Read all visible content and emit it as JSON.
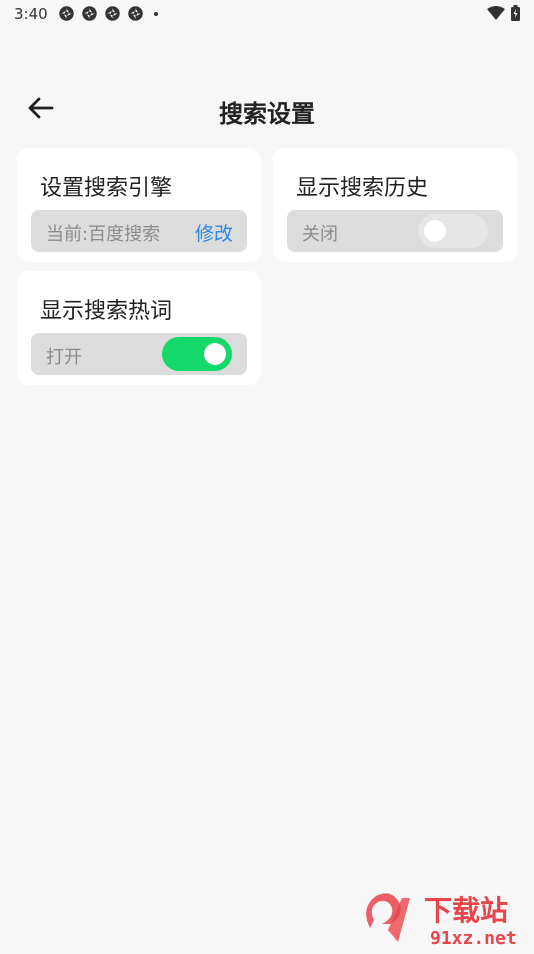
{
  "status_bar": {
    "time": "3:40"
  },
  "header": {
    "title": "搜索设置"
  },
  "cards": {
    "engine": {
      "title": "设置搜索引擎",
      "current": "当前:百度搜索",
      "modify_label": "修改"
    },
    "history": {
      "title": "显示搜索历史",
      "state_label": "关闭",
      "enabled": false
    },
    "hotwords": {
      "title": "显示搜索热词",
      "state_label": "打开",
      "enabled": true
    }
  },
  "watermark": {
    "text": "下载站",
    "domain": "91xz.net"
  },
  "colors": {
    "toggle_on": "#12d96a",
    "link": "#2a86e8",
    "watermark": "#e8454c"
  }
}
